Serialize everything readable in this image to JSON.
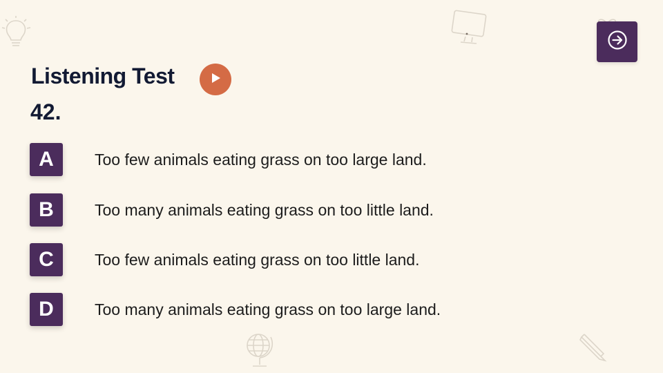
{
  "header": {
    "title": "Listening Test",
    "play_icon": "play-icon",
    "next_icon": "arrow-right-circle-icon"
  },
  "question": {
    "number": "42."
  },
  "options": [
    {
      "letter": "A",
      "text": "Too few animals eating grass on too large land."
    },
    {
      "letter": "B",
      "text": "Too many animals eating grass on too little land."
    },
    {
      "letter": "C",
      "text": "Too few animals eating grass on too little land."
    },
    {
      "letter": "D",
      "text": "Too many animals eating grass on too large land."
    }
  ],
  "colors": {
    "background": "#fbf6ec",
    "accent_purple": "#4b2c5c",
    "play_orange": "#d46b45",
    "title_text": "#121a33"
  },
  "decorations": [
    "lightbulb-icon",
    "computer-monitor-icon",
    "heart-icon",
    "globe-icon",
    "pencil-icon"
  ]
}
